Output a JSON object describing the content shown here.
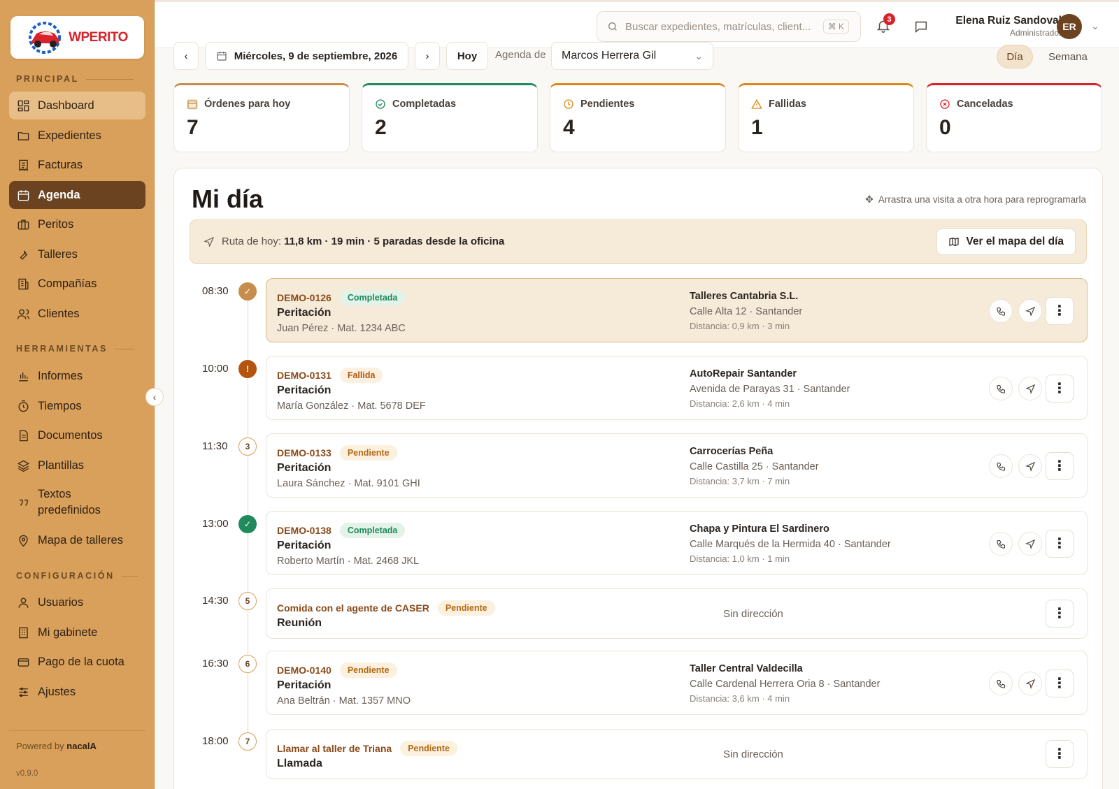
{
  "brand": {
    "name": "WPERITO",
    "accent": "#d9a05b",
    "dark": "#6b4320"
  },
  "sidebar": {
    "sections": {
      "principal": "PRINCIPAL",
      "herramientas": "HERRAMIENTAS",
      "configuracion": "CONFIGURACIÓN"
    },
    "items": [
      {
        "label": "Dashboard",
        "icon": "dashboard-icon"
      },
      {
        "label": "Expedientes",
        "icon": "folder-icon"
      },
      {
        "label": "Facturas",
        "icon": "invoice-icon"
      },
      {
        "label": "Agenda",
        "icon": "calendar-icon"
      },
      {
        "label": "Peritos",
        "icon": "briefcase-icon"
      },
      {
        "label": "Talleres",
        "icon": "wrench-icon"
      },
      {
        "label": "Compañías",
        "icon": "building-icon"
      },
      {
        "label": "Clientes",
        "icon": "users-icon"
      },
      {
        "label": "Informes",
        "icon": "bar-chart-icon"
      },
      {
        "label": "Tiempos",
        "icon": "timer-icon"
      },
      {
        "label": "Documentos",
        "icon": "document-icon"
      },
      {
        "label": "Plantillas",
        "icon": "layers-icon"
      },
      {
        "label": "Textos predefinidos",
        "icon": "quote-icon"
      },
      {
        "label": "Mapa de talleres",
        "icon": "map-pin-icon"
      },
      {
        "label": "Usuarios",
        "icon": "user-icon"
      },
      {
        "label": "Mi gabinete",
        "icon": "office-icon"
      },
      {
        "label": "Pago de la cuota",
        "icon": "credit-card-icon"
      },
      {
        "label": "Ajustes",
        "icon": "sliders-icon"
      }
    ],
    "powered_prefix": "Powered by",
    "powered_brand": "nacalA",
    "version": "v0.9.0"
  },
  "topbar": {
    "search_placeholder": "Buscar expedientes, matrículas, client...",
    "shortcut": "⌘ K",
    "notifications": "3",
    "user_name": "Elena Ruiz Sandoval",
    "user_role": "Administrador",
    "user_initials": "ER"
  },
  "datebar": {
    "prev": "‹",
    "date": "Miércoles, 9 de septiembre, 2026",
    "next": "›",
    "today": "Hoy",
    "agenda_label": "Agenda de",
    "agenda_person": "Marcos Herrera Gil",
    "view_day": "Día",
    "view_week": "Semana"
  },
  "stats": [
    {
      "label": "Órdenes para hoy",
      "value": "7",
      "color": "#c68d4c"
    },
    {
      "label": "Completadas",
      "value": "2",
      "color": "#1f8a5b"
    },
    {
      "label": "Pendientes",
      "value": "4",
      "color": "#d98a1a"
    },
    {
      "label": "Fallidas",
      "value": "1",
      "color": "#d98a1a"
    },
    {
      "label": "Canceladas",
      "value": "0",
      "color": "#d8232a"
    }
  ],
  "panel": {
    "title": "Mi día",
    "drag_hint": "Arrastra una visita a otra hora para reprogramarla",
    "route_prefix": "Ruta de hoy:",
    "route_summary": "11,8 km · 19 min · 5 paradas desde la oficina",
    "map_button": "Ver el mapa del día"
  },
  "visits": [
    {
      "time": "08:30",
      "marker": "✓",
      "code": "DEMO-0126",
      "status": "Completada",
      "type": "Peritación",
      "client": "Juan Pérez · Mat. 1234 ABC",
      "shop": "Talleres Cantabria S.L.",
      "address": "Calle Alta 12 · Santander",
      "distance": "Distancia: 0,9 km · 3 min"
    },
    {
      "time": "10:00",
      "marker": "!",
      "code": "DEMO-0131",
      "status": "Fallida",
      "type": "Peritación",
      "client": "María González · Mat. 5678 DEF",
      "shop": "AutoRepair Santander",
      "address": "Avenida de Parayas 31 · Santander",
      "distance": "Distancia: 2,6 km · 4 min"
    },
    {
      "time": "11:30",
      "marker": "3",
      "code": "DEMO-0133",
      "status": "Pendiente",
      "type": "Peritación",
      "client": "Laura Sánchez · Mat. 9101 GHI",
      "shop": "Carrocerías Peña",
      "address": "Calle Castilla 25 · Santander",
      "distance": "Distancia: 3,7 km · 7 min"
    },
    {
      "time": "13:00",
      "marker": "✓",
      "code": "DEMO-0138",
      "status": "Completada",
      "type": "Peritación",
      "client": "Roberto Martín · Mat. 2468 JKL",
      "shop": "Chapa y Pintura El Sardinero",
      "address": "Calle Marqués de la Hermida 40 · Santander",
      "distance": "Distancia: 1,0 km · 1 min"
    },
    {
      "time": "14:30",
      "marker": "5",
      "code": "Comida con el agente de CASER",
      "status": "Pendiente",
      "type": "Reunión",
      "no_address": "Sin dirección"
    },
    {
      "time": "16:30",
      "marker": "6",
      "code": "DEMO-0140",
      "status": "Pendiente",
      "type": "Peritación",
      "client": "Ana Beltrán · Mat. 1357 MNO",
      "shop": "Taller Central Valdecilla",
      "address": "Calle Cardenal Herrera Oria 8 · Santander",
      "distance": "Distancia: 3,6 km · 4 min"
    },
    {
      "time": "18:00",
      "marker": "7",
      "code": "Llamar al taller de Triana",
      "status": "Pendiente",
      "type": "Llamada",
      "no_address": "Sin dirección"
    }
  ]
}
